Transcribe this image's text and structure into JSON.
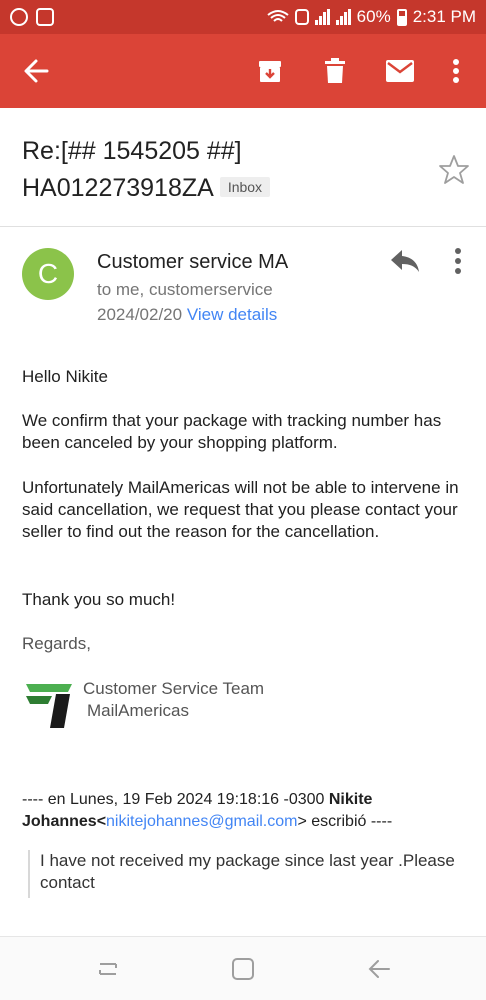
{
  "status_bar": {
    "battery": "60%",
    "time": "2:31 PM"
  },
  "toolbar": {
    "back_icon": "arrow-back-icon",
    "archive_icon": "archive-icon",
    "delete_icon": "trash-icon",
    "mark_unread_icon": "mail-icon",
    "more_icon": "more-vert-icon",
    "color": "#db4437"
  },
  "email": {
    "subject_line1": "Re:[## 1545205 ##]",
    "subject_line2": "HA012273918ZA",
    "label": "Inbox",
    "sender": {
      "initial": "C",
      "name": "Customer service MA",
      "recipients": "to me, customerservice",
      "date": "2024/02/20",
      "view_details": "View details",
      "avatar_color": "#8bc34a"
    },
    "body": {
      "greeting": "Hello Nikite",
      "p1": "We confirm that your package with tracking number has been canceled by your shopping platform.",
      "p2": "Unfortunately MailAmericas will not be able to intervene in said cancellation, we request that you please contact your seller to find out the reason for the cancellation.",
      "p3": "Thank you so much!",
      "regards": "Regards,",
      "signature_line1": "Customer Service Team",
      "signature_line2": "MailAmericas"
    },
    "quote": {
      "intro": "---- en Lunes, 19 Feb 2024 19:18:16 -0300 ",
      "author": "Nikite Johannes",
      "lt": "<",
      "email": "nikitejohannes@gmail.com",
      "gt": ">",
      "suffix": " escribió ----",
      "text": "I have not received my package since last year .Please contact"
    }
  },
  "navbar": {
    "recents_icon": "recents-icon",
    "home_icon": "home-icon",
    "back_icon": "nav-back-icon"
  }
}
